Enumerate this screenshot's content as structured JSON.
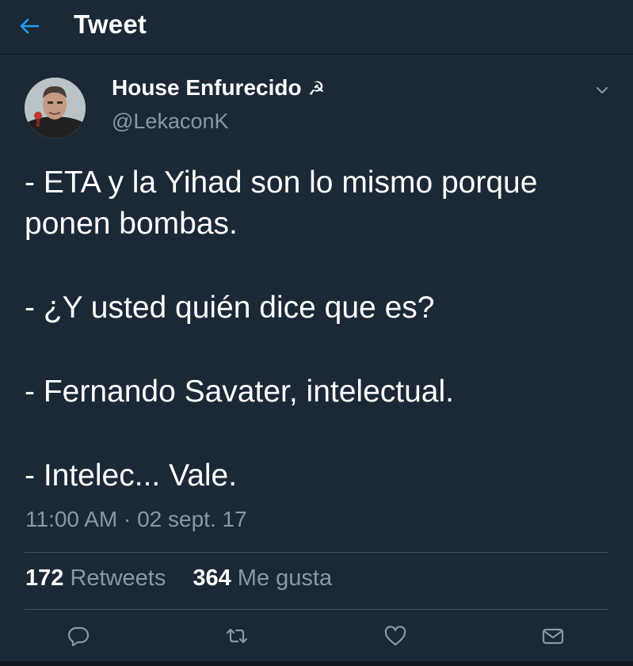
{
  "header": {
    "title": "Tweet",
    "back_icon": "back-arrow-icon",
    "accent_color": "#1da1f2"
  },
  "tweet": {
    "display_name": "House Enfurecido",
    "name_icon_glyph": "☭",
    "handle": "@LekaconK",
    "lines": [
      "- ETA y la Yihad son lo mismo porque ponen bombas.",
      "- ¿Y usted quién dice que es?",
      "- Fernando Savater, intelectual.",
      "- Intelec... Vale."
    ],
    "timestamp": "11:00 AM · 02 sept. 17"
  },
  "stats": {
    "retweets_count": "172",
    "retweets_label": "Retweets",
    "likes_count": "364",
    "likes_label": "Me gusta"
  },
  "actions": [
    "reply-icon",
    "retweet-icon",
    "like-icon",
    "message-icon"
  ],
  "colors": {
    "background": "#1b2836",
    "secondary_text": "#8899a6",
    "divider": "#3d5466"
  }
}
